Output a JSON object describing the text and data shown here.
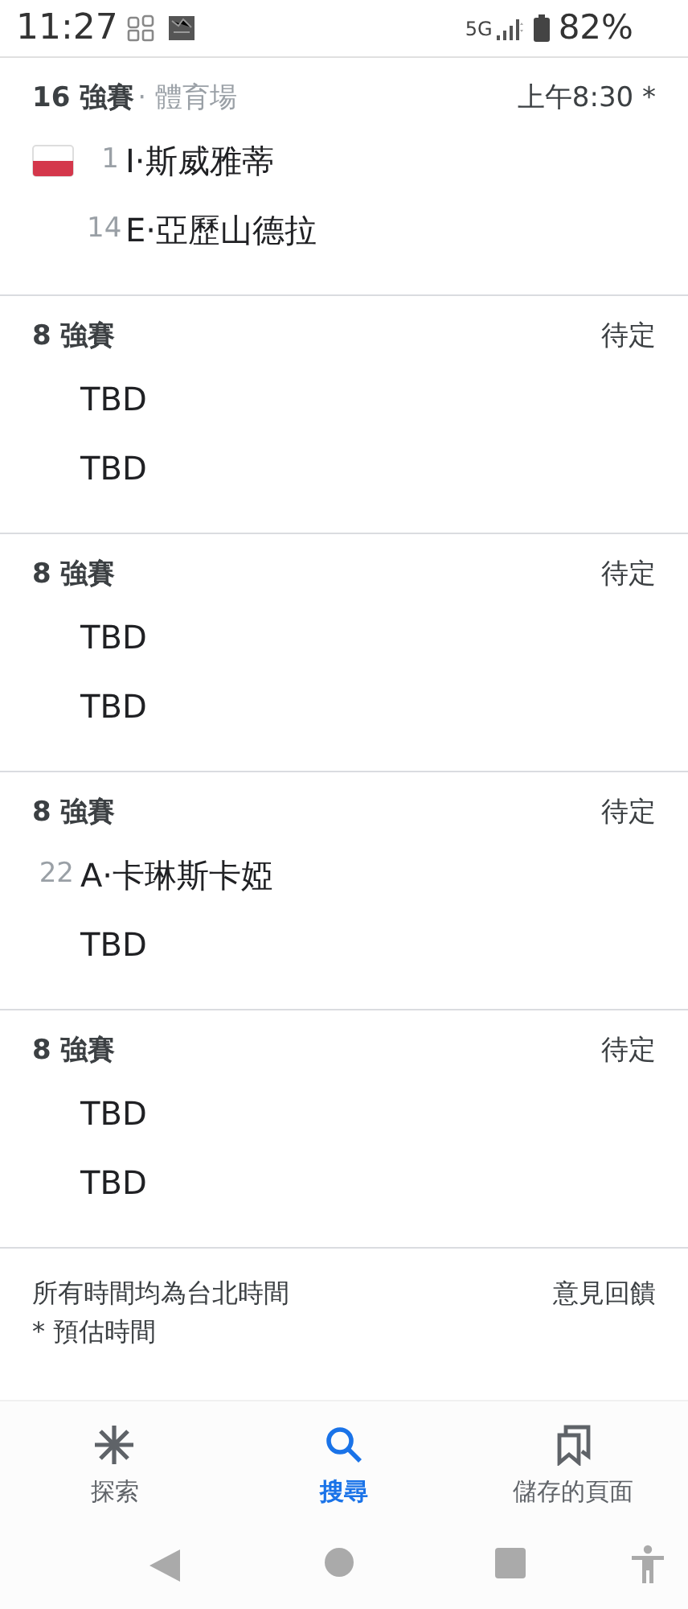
{
  "status_bar": {
    "time": "11:27",
    "network": "5G",
    "battery": "82%"
  },
  "matches": [
    {
      "round": "16 強賽",
      "venue": "· 體育場",
      "time": "上午8:30 *",
      "players": [
        {
          "seed": "1",
          "name": "I·斯威雅蒂",
          "flag": true
        },
        {
          "seed": "14",
          "name": "E·亞歷山德拉",
          "flag": false
        }
      ]
    },
    {
      "round": "8 強賽",
      "time": "待定",
      "players": [
        {
          "name": "TBD"
        },
        {
          "name": "TBD"
        }
      ]
    },
    {
      "round": "8 強賽",
      "time": "待定",
      "players": [
        {
          "name": "TBD"
        },
        {
          "name": "TBD"
        }
      ]
    },
    {
      "round": "8 強賽",
      "time": "待定",
      "players": [
        {
          "seed": "22",
          "name": "A·卡琳斯卡婭"
        },
        {
          "name": "TBD"
        }
      ]
    },
    {
      "round": "8 強賽",
      "time": "待定",
      "players": [
        {
          "name": "TBD"
        },
        {
          "name": "TBD"
        }
      ]
    }
  ],
  "footer": {
    "note": "所有時間均為台北時間",
    "estimate_note": "* 預估時間",
    "feedback": "意見回饋"
  },
  "bottom_nav": [
    {
      "kind": "explore",
      "label": "探索",
      "selected": false
    },
    {
      "kind": "search",
      "label": "搜尋",
      "selected": true
    },
    {
      "kind": "saved",
      "label": "儲存的頁面",
      "selected": false
    }
  ]
}
